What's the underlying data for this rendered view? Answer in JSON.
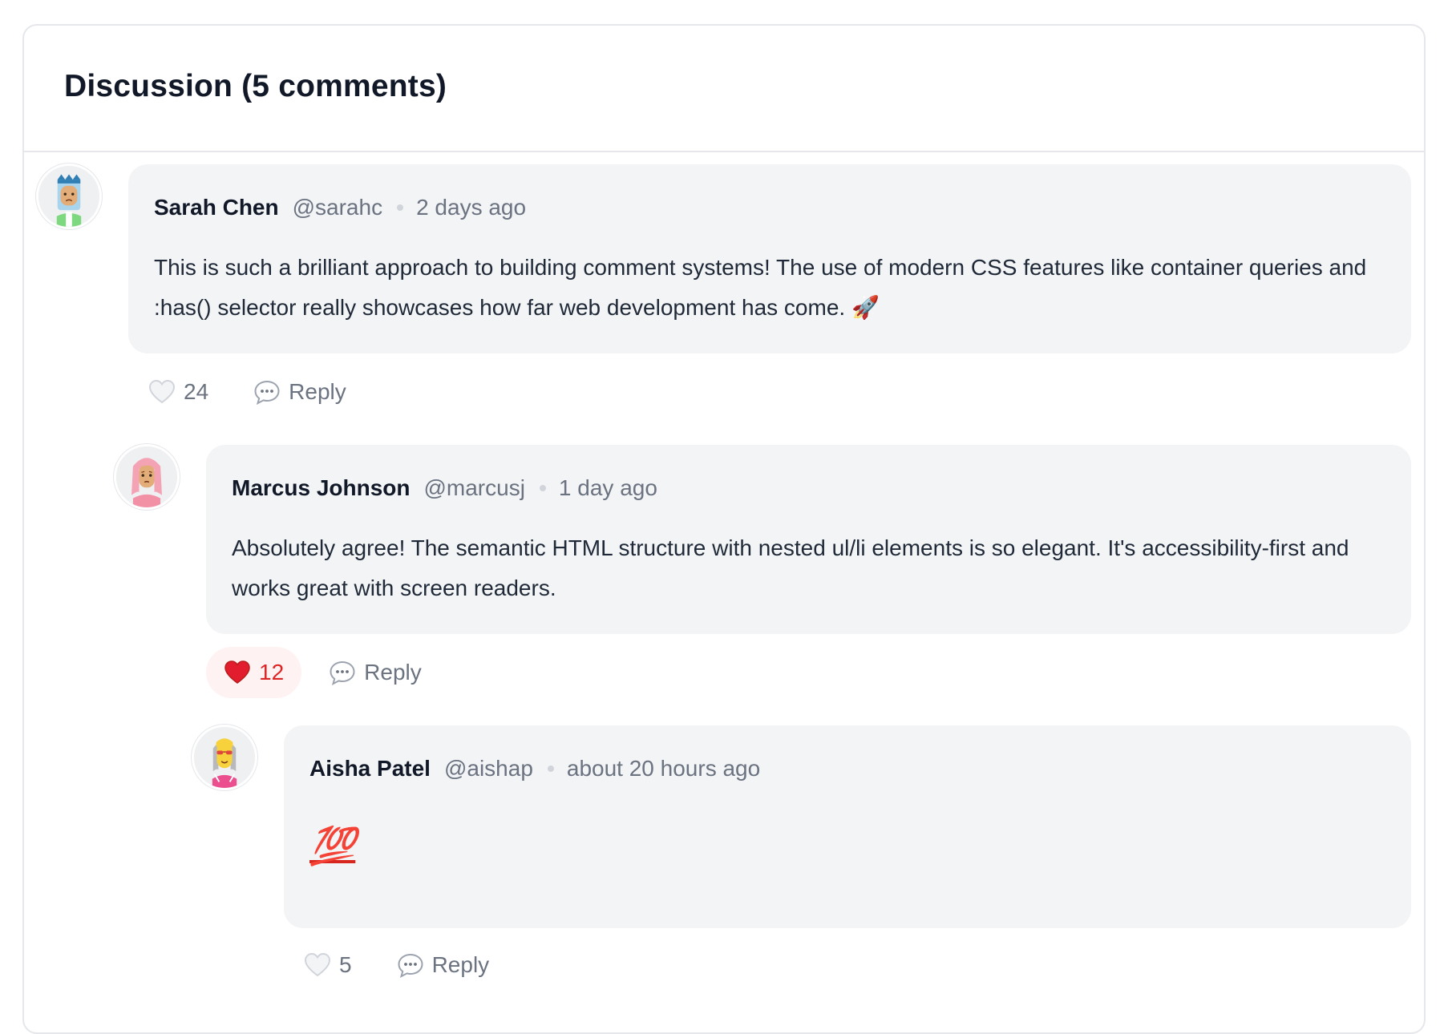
{
  "discussion": {
    "title": "Discussion (5 comments)"
  },
  "colors": {
    "bubble": "#f3f4f6",
    "liked_bg": "#fef2f2",
    "liked_text": "#dc2626",
    "muted": "#6b7280"
  },
  "comments": [
    {
      "author": "Sarah Chen",
      "handle": "@sarahc",
      "time": "2 days ago",
      "body": "This is such a brilliant approach to building comment systems! The use of modern CSS features like container queries and :has() selector really showcases how far web development has come. 🚀",
      "likes": "24",
      "liked": false,
      "reply_label": "Reply",
      "avatar_icon": "avatar-sarah-icon"
    },
    {
      "author": "Marcus Johnson",
      "handle": "@marcusj",
      "time": "1 day ago",
      "body": "Absolutely agree! The semantic HTML structure with nested ul/li elements is so elegant. It's accessibility-first and works great with screen readers.",
      "likes": "12",
      "liked": true,
      "reply_label": "Reply",
      "avatar_icon": "avatar-marcus-icon"
    },
    {
      "author": "Aisha Patel",
      "handle": "@aishap",
      "time": "about 20 hours ago",
      "body": "💯",
      "likes": "5",
      "liked": false,
      "reply_label": "Reply",
      "avatar_icon": "avatar-aisha-icon"
    }
  ]
}
